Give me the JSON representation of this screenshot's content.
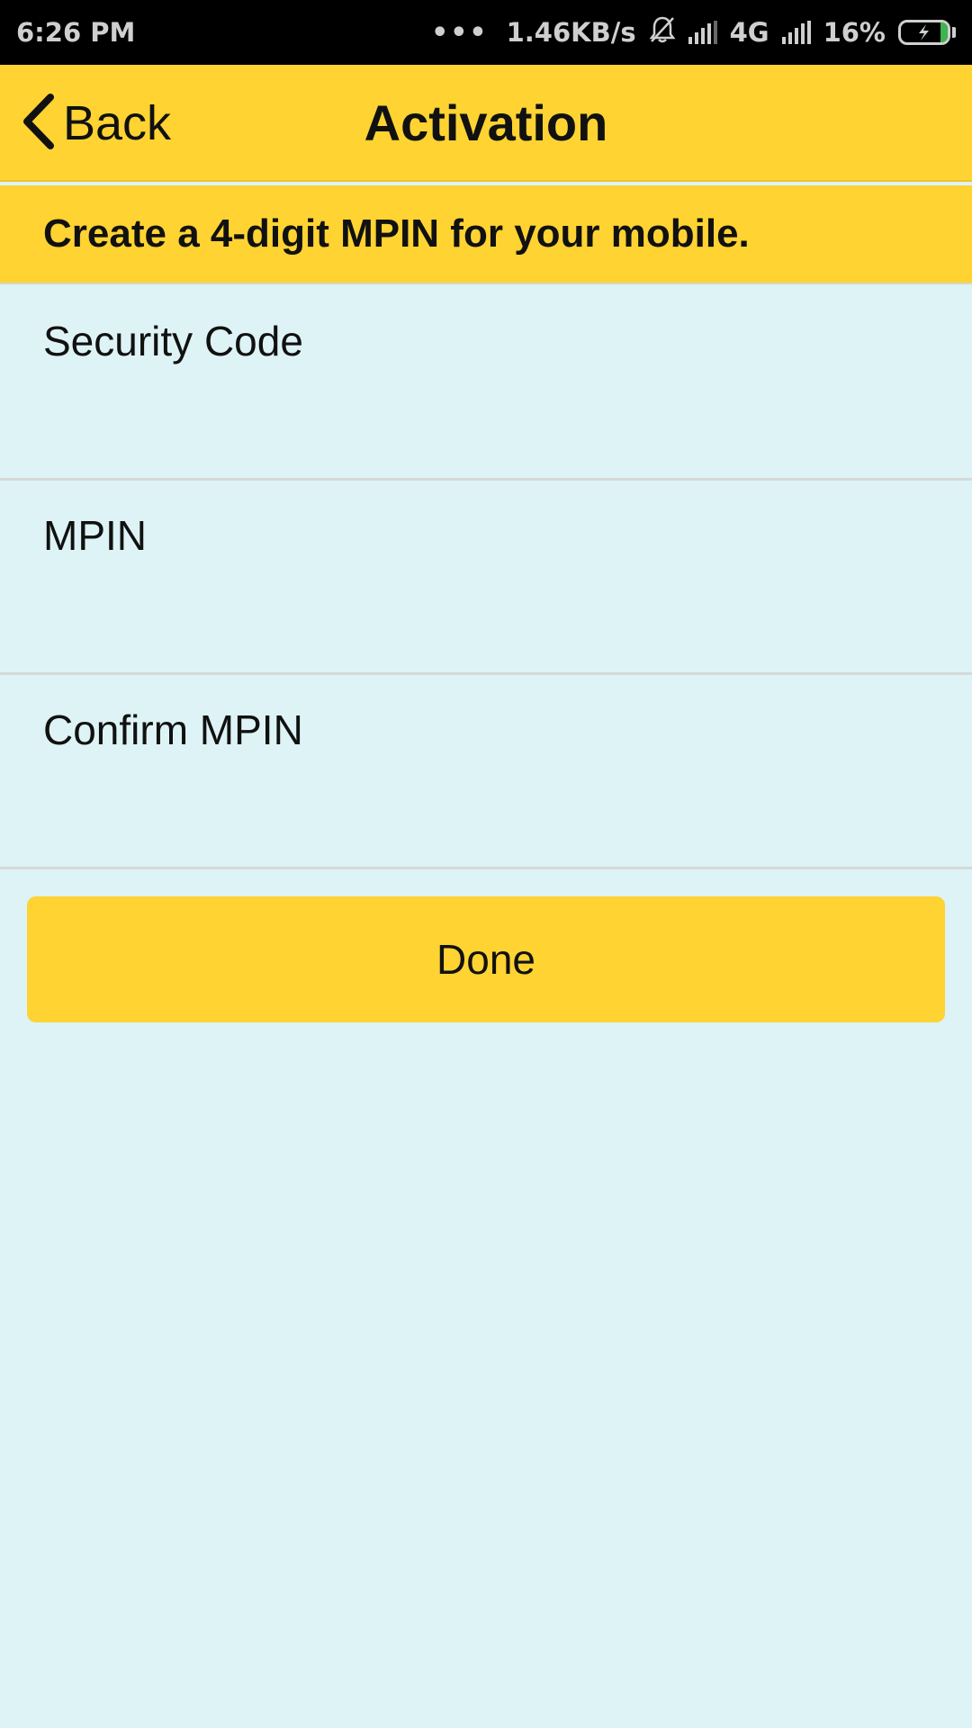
{
  "status_bar": {
    "time": "6:26 PM",
    "dots": "•••",
    "speed": "1.46KB/s",
    "network": "4G",
    "battery": "16%",
    "battery_level": 0.16,
    "icons": [
      "bell-muted-icon",
      "signal-icon",
      "signal-icon",
      "battery-charging-icon"
    ]
  },
  "header": {
    "back_label": "Back",
    "title": "Activation"
  },
  "banner": {
    "text": "Create a 4-digit MPIN for your mobile."
  },
  "form": {
    "fields": [
      {
        "label": "Security Code",
        "value": ""
      },
      {
        "label": "MPIN",
        "value": ""
      },
      {
        "label": "Confirm MPIN",
        "value": ""
      }
    ],
    "submit_label": "Done"
  },
  "colors": {
    "accent": "#fed332",
    "background": "#def3f5",
    "status_bar": "#000000",
    "battery_charge": "#3fb34f"
  }
}
